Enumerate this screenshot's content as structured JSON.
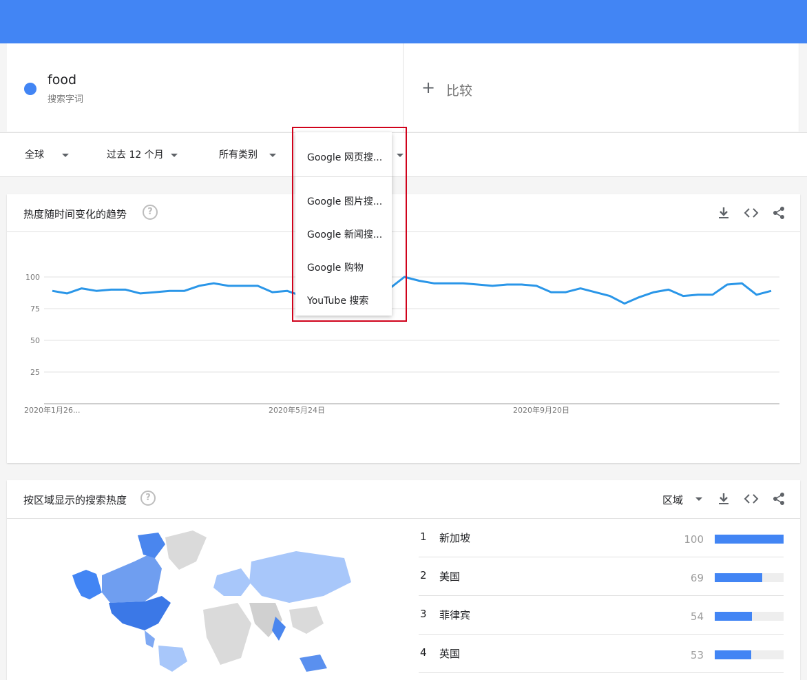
{
  "term": {
    "name": "food",
    "type": "搜索字词"
  },
  "compare": {
    "plus": "+",
    "label": "比较"
  },
  "filters": {
    "region": "全球",
    "time": "过去 12 个月",
    "category": "所有类别",
    "search_type": "Google 网页搜..."
  },
  "dropdown": {
    "selected": "Google 网页搜...",
    "options": [
      "Google 图片搜...",
      "Google 新闻搜...",
      "Google 购物",
      "YouTube 搜索"
    ]
  },
  "trend_card": {
    "title": "热度随时间变化的趋势",
    "help": "?"
  },
  "region_card": {
    "title": "按区域显示的搜索热度",
    "help": "?",
    "resolution": "区域"
  },
  "icons": {
    "download": "download-icon",
    "embed": "embed-code-icon",
    "share": "share-icon",
    "help": "help-icon"
  },
  "colors": {
    "accent": "#4285f4",
    "line": "#2a96e8",
    "highlight": "#d0021b"
  },
  "chart_data": {
    "type": "line",
    "x_tick_labels": [
      "2020年1月26...",
      "2020年5月24日",
      "2020年9月20日"
    ],
    "y_ticks": [
      25,
      50,
      75,
      100
    ],
    "ylim": [
      0,
      100
    ],
    "grid": true,
    "series": [
      {
        "values": [
          89,
          87,
          91,
          89,
          90,
          90,
          87,
          88,
          89,
          89,
          93,
          95,
          93,
          93,
          93,
          88,
          89,
          85,
          84,
          84,
          88,
          88,
          91,
          91,
          100,
          97,
          95,
          95,
          95,
          94,
          93,
          94,
          94,
          93,
          88,
          88,
          91,
          88,
          85,
          79,
          84,
          88,
          90,
          85,
          86,
          86,
          94,
          95,
          86,
          89
        ]
      }
    ]
  },
  "regions": [
    {
      "rank": "1",
      "name": "新加坡",
      "value": 100
    },
    {
      "rank": "2",
      "name": "美国",
      "value": 69
    },
    {
      "rank": "3",
      "name": "菲律宾",
      "value": 54
    },
    {
      "rank": "4",
      "name": "英国",
      "value": 53
    }
  ]
}
